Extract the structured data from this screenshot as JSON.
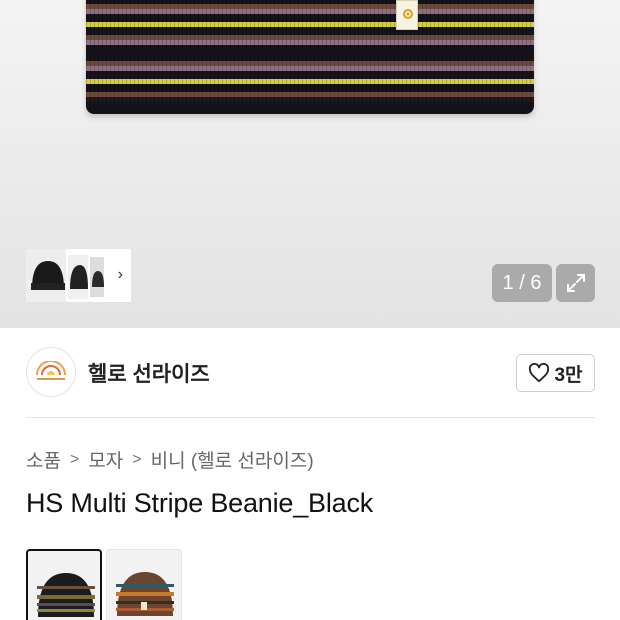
{
  "gallery": {
    "counter": "1 / 6",
    "thumbnails_more_icon": "chevron-right-icon",
    "expand_icon": "expand-arrows-icon",
    "stripe_colors": [
      "#15131a",
      "#6e4a3b",
      "#8f6f86",
      "#d4cf3a",
      "#1a1820"
    ]
  },
  "seller": {
    "name": "헬로 선라이즈",
    "logo_icon": "sunrise-logo-icon",
    "like_count": "3만",
    "like_icon": "heart-outline-icon"
  },
  "breadcrumb": [
    "소품",
    "모자",
    "비니 (헬로 선라이즈)"
  ],
  "product": {
    "title": "HS Multi Stripe Beanie_Black"
  },
  "color_options": [
    {
      "name": "black",
      "selected": true
    },
    {
      "name": "brown",
      "selected": false
    }
  ]
}
